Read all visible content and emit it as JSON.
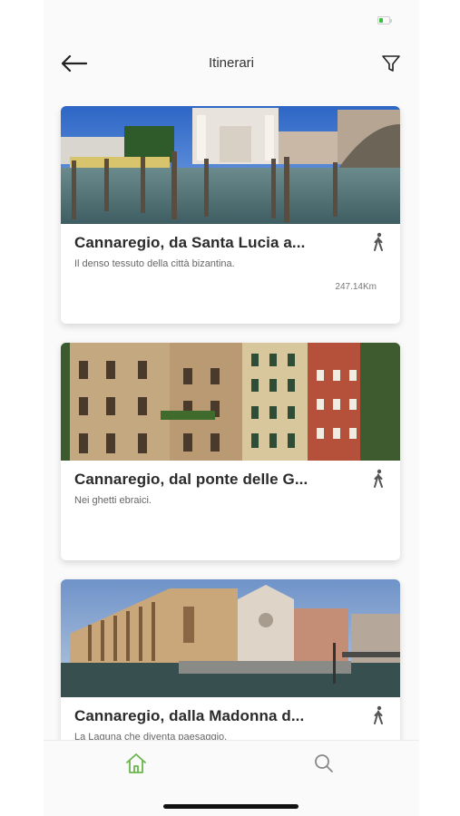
{
  "header": {
    "title": "Itinerari",
    "back_icon": "arrow-left-icon",
    "filter_icon": "filter-funnel-icon"
  },
  "itineraries": [
    {
      "title": "Cannaregio, da Santa Lucia a...",
      "subtitle": "Il denso tessuto della città bizantina.",
      "distance": "247.14Km",
      "mode_icon": "walking-person-icon"
    },
    {
      "title": "Cannaregio, dal ponte delle G...",
      "subtitle": "Nei ghetti ebraici.",
      "distance": "",
      "mode_icon": "walking-person-icon"
    },
    {
      "title": "Cannaregio, dalla Madonna d...",
      "subtitle": "La Laguna che diventa paesaggio.",
      "distance": "",
      "mode_icon": "walking-person-icon"
    }
  ],
  "tab_bar": {
    "items": [
      {
        "icon": "home-icon",
        "active": true
      },
      {
        "icon": "search-icon",
        "active": false
      }
    ],
    "active_color": "#6bb54a",
    "inactive_color": "#888888"
  },
  "colors": {
    "battery": "#35c13c",
    "background": "#fafafa",
    "card": "#ffffff"
  }
}
